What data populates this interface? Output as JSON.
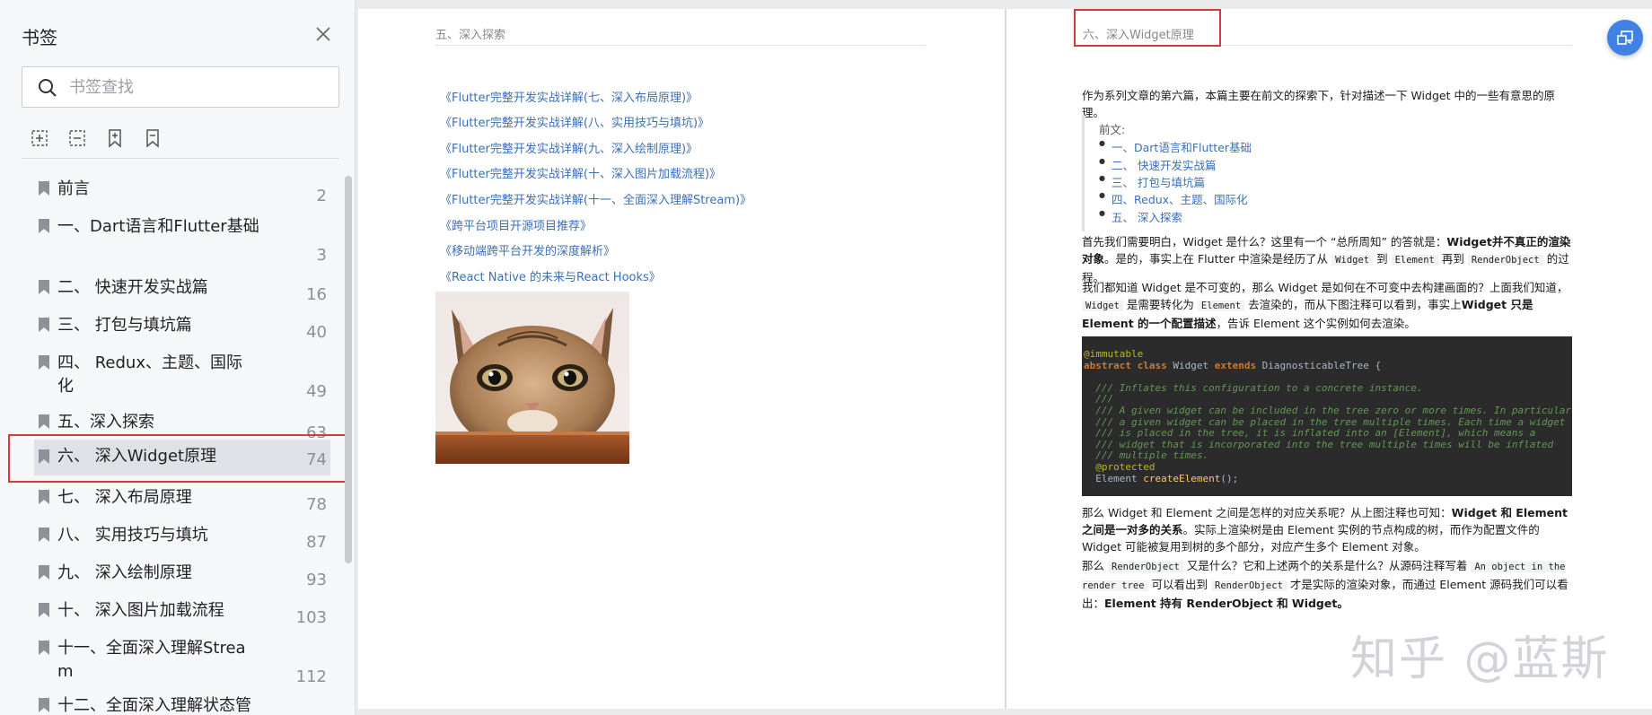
{
  "sidebar": {
    "title": "书签",
    "search_placeholder": "书签查找",
    "bookmarks": [
      {
        "label": "前言",
        "page": "2"
      },
      {
        "label": "一、Dart语言和Flutter基础",
        "page": "3"
      },
      {
        "label": "二、 快速开发实战篇",
        "page": "16"
      },
      {
        "label": "三、 打包与填坑篇",
        "page": "40"
      },
      {
        "label": "四、 Redux、主题、国际化",
        "page": "49"
      },
      {
        "label": "五、深入探索",
        "page": "63"
      },
      {
        "label": "六、 深入Widget原理",
        "page": "74"
      },
      {
        "label": "七、 深入布局原理",
        "page": "78"
      },
      {
        "label": "八、 实用技巧与填坑",
        "page": "87"
      },
      {
        "label": "九、 深入绘制原理",
        "page": "93"
      },
      {
        "label": "十、 深入图片加载流程",
        "page": "103"
      },
      {
        "label": "十一、全面深入理解Stream",
        "page": "112"
      },
      {
        "label": "十二、全面深入理解状态管",
        "page": ""
      }
    ]
  },
  "left_page": {
    "header": "五、深入探索",
    "links": [
      "《Flutter完整开发实战详解(七、深入布局原理)》",
      "《Flutter完整开发实战详解(八、实用技巧与填坑)》",
      "《Flutter完整开发实战详解(九、深入绘制原理)》",
      "《Flutter完整开发实战详解(十、深入图片加载流程)》",
      "《Flutter完整开发实战详解(十一、全面深入理解Stream)》",
      "《跨平台项目开源项目推荐》",
      "《移动端跨平台开发的深度解析》",
      "《React Native 的未来与React Hooks》"
    ]
  },
  "right_page": {
    "header": "六、深入Widget原理",
    "intro": "作为系列文章的第六篇，本篇主要在前文的探索下，针对描述一下 Widget 中的一些有意思的原理。",
    "quote_title": "前文:",
    "quote_items": [
      "一、Dart语言和Flutter基础",
      "二、 快速开发实战篇",
      "三、 打包与填坑篇",
      "四、Redux、主题、国际化",
      "五、 深入探索"
    ],
    "p1": {
      "a": "首先我们需要明白，Widget 是什么？这里有一个 “总所周知” 的答就是：",
      "b": "Widget并不真正的渲染对象",
      "c": "。是的，事实上在 Flutter 中渲染是经历了从",
      "code1": "Widget",
      "d": "到",
      "code2": "Element",
      "e": "再到",
      "code3": "RenderObject",
      "f": "的过程。"
    },
    "p2": {
      "a": "我们都知道 Widget 是不可变的，那么 Widget 是如何在不可变中去构建画面的？上面我们知道，",
      "code1": "Widget",
      "b": "是需要转化为",
      "code2": "Element",
      "c": "去渲染的，而从下图注释可以看到，事实上",
      "d": "Widget 只是 Element 的一个配置描述",
      "e": "，告诉 Element 这个实例如何去渲染。"
    },
    "code_lines": {
      "l1": "@immutable",
      "l2a": "abstract class",
      "l2b": " Widget ",
      "l2c": "extends",
      "l2d": " DiagnosticableTree {",
      "l3": "  /// Inflates this configuration to a concrete instance.",
      "l4": "  ///",
      "l5": "  /// A given widget can be included in the tree zero or more times. In particular",
      "l6": "  /// a given widget can be placed in the tree multiple times. Each time a widget",
      "l7": "  /// is placed in the tree, it is inflated into an [Element], which means a",
      "l8": "  /// widget that is incorporated into the tree multiple times will be inflated",
      "l9": "  /// multiple times.",
      "l10": "  @protected",
      "l11a": "  Element ",
      "l11b": "createElement",
      "l11c": "();"
    },
    "p3": {
      "a": "那么 Widget 和 Element 之间是怎样的对应关系呢？从上图注释也可知：",
      "b": "Widget 和 Element 之间是一对多的关系",
      "c": "。实际上渲染树是由 Element 实例的节点构成的树，而作为配置文件的 Widget 可能被复用到树的多个部分，对应产生多个 Element 对象。"
    },
    "p4": {
      "a": "那么",
      "code1": "RenderObject",
      "b": "又是什么？它和上述两个的关系是什么？从源码注释写着",
      "code2": "An object in the render tree",
      "c": "可以看出到",
      "code3": "RenderObject",
      "d": "才是实际的渲染对象，而通过 Element 源码我们可以看出：",
      "e": "Element 持有 RenderObject 和 Widget。"
    }
  },
  "watermark": "知乎 @蓝斯",
  "colors": {
    "accent": "#3f82e3",
    "link": "#3b6fb6",
    "highlight_border": "#d63b3b",
    "sidebar_bg": "#f6f7f9",
    "code_bg": "#2b2b2b"
  },
  "icons": {
    "close": "close-icon",
    "search": "search-icon",
    "tools": [
      "expand-all-icon",
      "collapse-all-icon",
      "add-bookmark-icon",
      "remove-bookmark-icon"
    ],
    "bookmark": "bookmark-icon",
    "fab": "screen-switch-icon"
  }
}
